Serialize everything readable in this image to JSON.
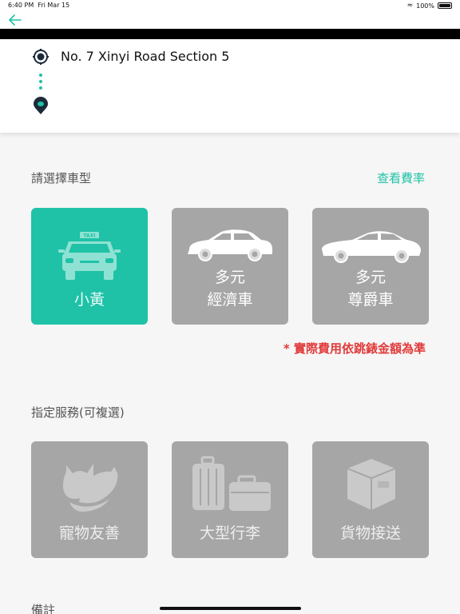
{
  "status_bar": {
    "time": "6:40 PM",
    "date": "Fri Mar 15",
    "battery": "100%"
  },
  "nav": {
    "back_icon": "arrow-left-icon"
  },
  "route": {
    "origin": "No. 7 Xinyi Road Section 5"
  },
  "car_section": {
    "title": "請選擇車型",
    "rate_link": "查看費率",
    "options": [
      {
        "line1": "小黃",
        "line2": "",
        "selected": true,
        "icon": "taxi-icon"
      },
      {
        "line1": "多元",
        "line2": "經濟車",
        "selected": false,
        "icon": "sedan-icon"
      },
      {
        "line1": "多元",
        "line2": "尊爵車",
        "selected": false,
        "icon": "luxury-sedan-icon"
      }
    ],
    "note": "* 實際費用依跳錶金額為準"
  },
  "service_section": {
    "title": "指定服務(可複選)",
    "options": [
      {
        "label": "寵物友善",
        "icon": "pet-icon"
      },
      {
        "label": "大型行李",
        "icon": "luggage-icon"
      },
      {
        "label": "貨物接送",
        "icon": "package-icon"
      }
    ]
  },
  "remarks_section": {
    "title": "備註"
  },
  "colors": {
    "accent": "#1fc2a7",
    "card_gray": "#a6a6a6",
    "warning": "#e23b3b"
  }
}
